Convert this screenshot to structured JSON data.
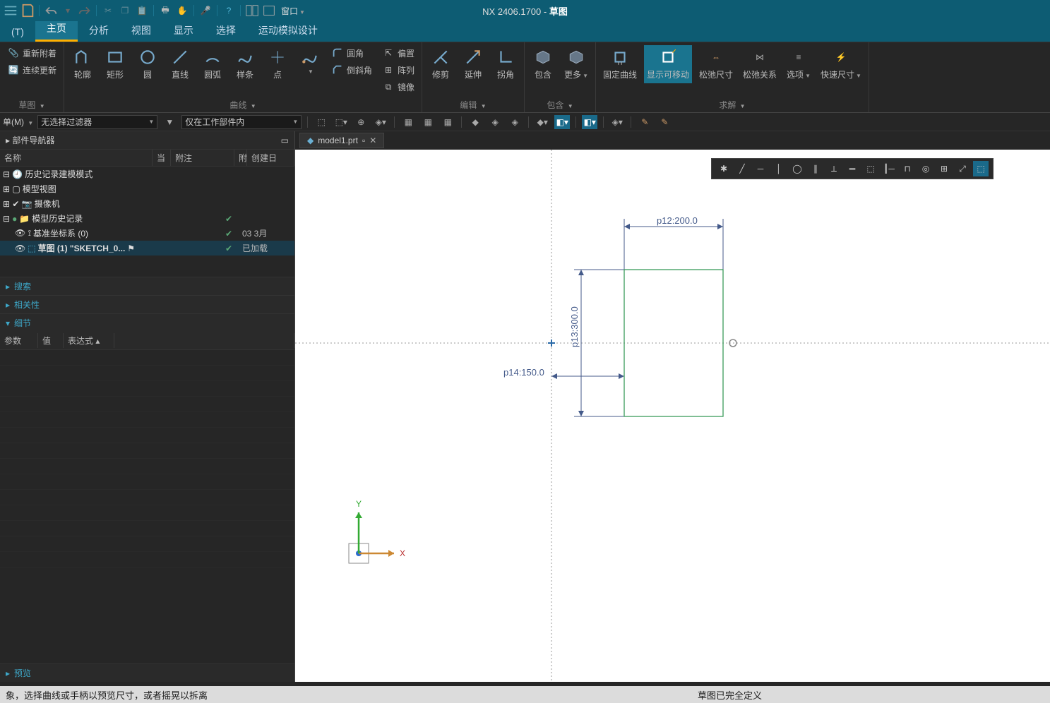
{
  "app": {
    "title_prefix": "NX 2406.1700",
    "title_suffix": "草图"
  },
  "qat": {
    "window_label": "窗口"
  },
  "menutab_file": "(T)",
  "maintabs": [
    "主页",
    "分析",
    "视图",
    "显示",
    "选择",
    "运动模拟设计"
  ],
  "maintab_active": 0,
  "ribbon": {
    "group_sketch": {
      "title": "草图",
      "reattach": "重新附着",
      "cont": "连续更新"
    },
    "group_curve": {
      "title": "曲线",
      "profile": "轮廓",
      "rect": "矩形",
      "circle": "圆",
      "line": "直线",
      "arc": "圆弧",
      "spline": "样条",
      "point": "点",
      "fillet": "圆角",
      "chamfer": "倒斜角",
      "offset": "偏置",
      "array": "阵列",
      "mirror": "镜像"
    },
    "group_edit": {
      "title": "编辑",
      "trim": "修剪",
      "extend": "延伸",
      "corner": "拐角"
    },
    "group_include": {
      "title": "包含",
      "include": "包含",
      "more": "更多"
    },
    "group_solve": {
      "title": "求解",
      "fixcurve": "固定曲线",
      "showmove": "显示可移动",
      "relaxdim": "松弛尺寸",
      "relaxrel": "松弛关系",
      "options": "选项",
      "rapid": "快速尺寸"
    }
  },
  "selbar": {
    "menu": "单(M)",
    "filter": "无选择过滤器",
    "scope": "仅在工作部件内"
  },
  "leftpanel": {
    "header": "部件导航器",
    "cols": {
      "name": "名称",
      "c1": "当",
      "c2": "附注",
      "c3": "附",
      "c4": "创建日"
    },
    "tree": {
      "history_mode": "历史记录建模模式",
      "model_view": "模型视图",
      "camera": "摄像机",
      "model_hist": "模型历史记录",
      "datum": "基准坐标系 (0)",
      "sketch": "草图 (1) \"SKETCH_0...",
      "datum_date": "03 3月",
      "sketch_status": "已加载"
    },
    "sections": {
      "search": "搜索",
      "related": "相关性",
      "detail": "细节",
      "preview": "预览"
    },
    "detail_cols": {
      "param": "参数",
      "value": "值",
      "expr": "表达式"
    }
  },
  "doctab": {
    "name": "model1.prt"
  },
  "sketch": {
    "dim_p12": "p12:200.0",
    "dim_p13": "p13:300.0",
    "dim_p14": "p14:150.0",
    "axis_x": "X",
    "axis_y": "Y"
  },
  "statusbar": {
    "hint": "象，选择曲线或手柄以预览尺寸，或者摇晃以拆离",
    "state": "草图已完全定义"
  }
}
